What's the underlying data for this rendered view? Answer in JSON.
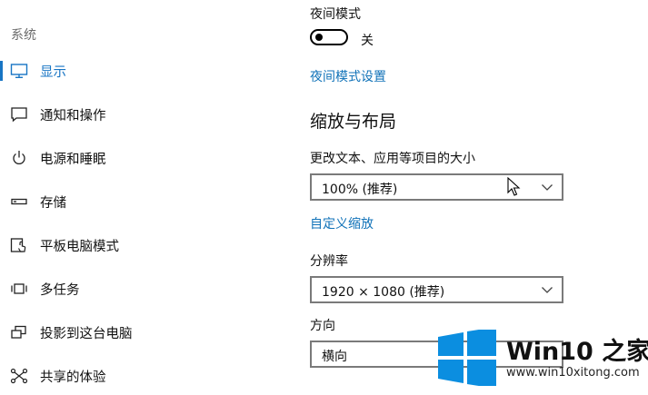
{
  "sidebar": {
    "heading": "系统",
    "items": [
      {
        "label": "显示",
        "icon": "monitor-icon",
        "active": true
      },
      {
        "label": "通知和操作",
        "icon": "notification-icon",
        "active": false
      },
      {
        "label": "电源和睡眠",
        "icon": "power-icon",
        "active": false
      },
      {
        "label": "存储",
        "icon": "storage-icon",
        "active": false
      },
      {
        "label": "平板电脑模式",
        "icon": "tablet-mode-icon",
        "active": false
      },
      {
        "label": "多任务",
        "icon": "multitasking-icon",
        "active": false
      },
      {
        "label": "投影到这台电脑",
        "icon": "projecting-icon",
        "active": false
      },
      {
        "label": "共享的体验",
        "icon": "shared-experiences-icon",
        "active": false
      }
    ]
  },
  "night_mode": {
    "label": "夜间模式",
    "state_label": "关",
    "enabled": false,
    "settings_link": "夜间模式设置"
  },
  "scale_layout": {
    "heading": "缩放与布局",
    "scale_label": "更改文本、应用等项目的大小",
    "scale_value": "100% (推荐)",
    "custom_scale_link": "自定义缩放",
    "resolution_label": "分辨率",
    "resolution_value": "1920 × 1080 (推荐)",
    "orientation_label": "方向",
    "orientation_value": "横向"
  },
  "watermark": {
    "title": "Win10 之家",
    "url": "www.win10xitong.com"
  },
  "colors": {
    "accent": "#1875c4",
    "link": "#1072b8",
    "logo_blue": "#0b8ee0"
  }
}
